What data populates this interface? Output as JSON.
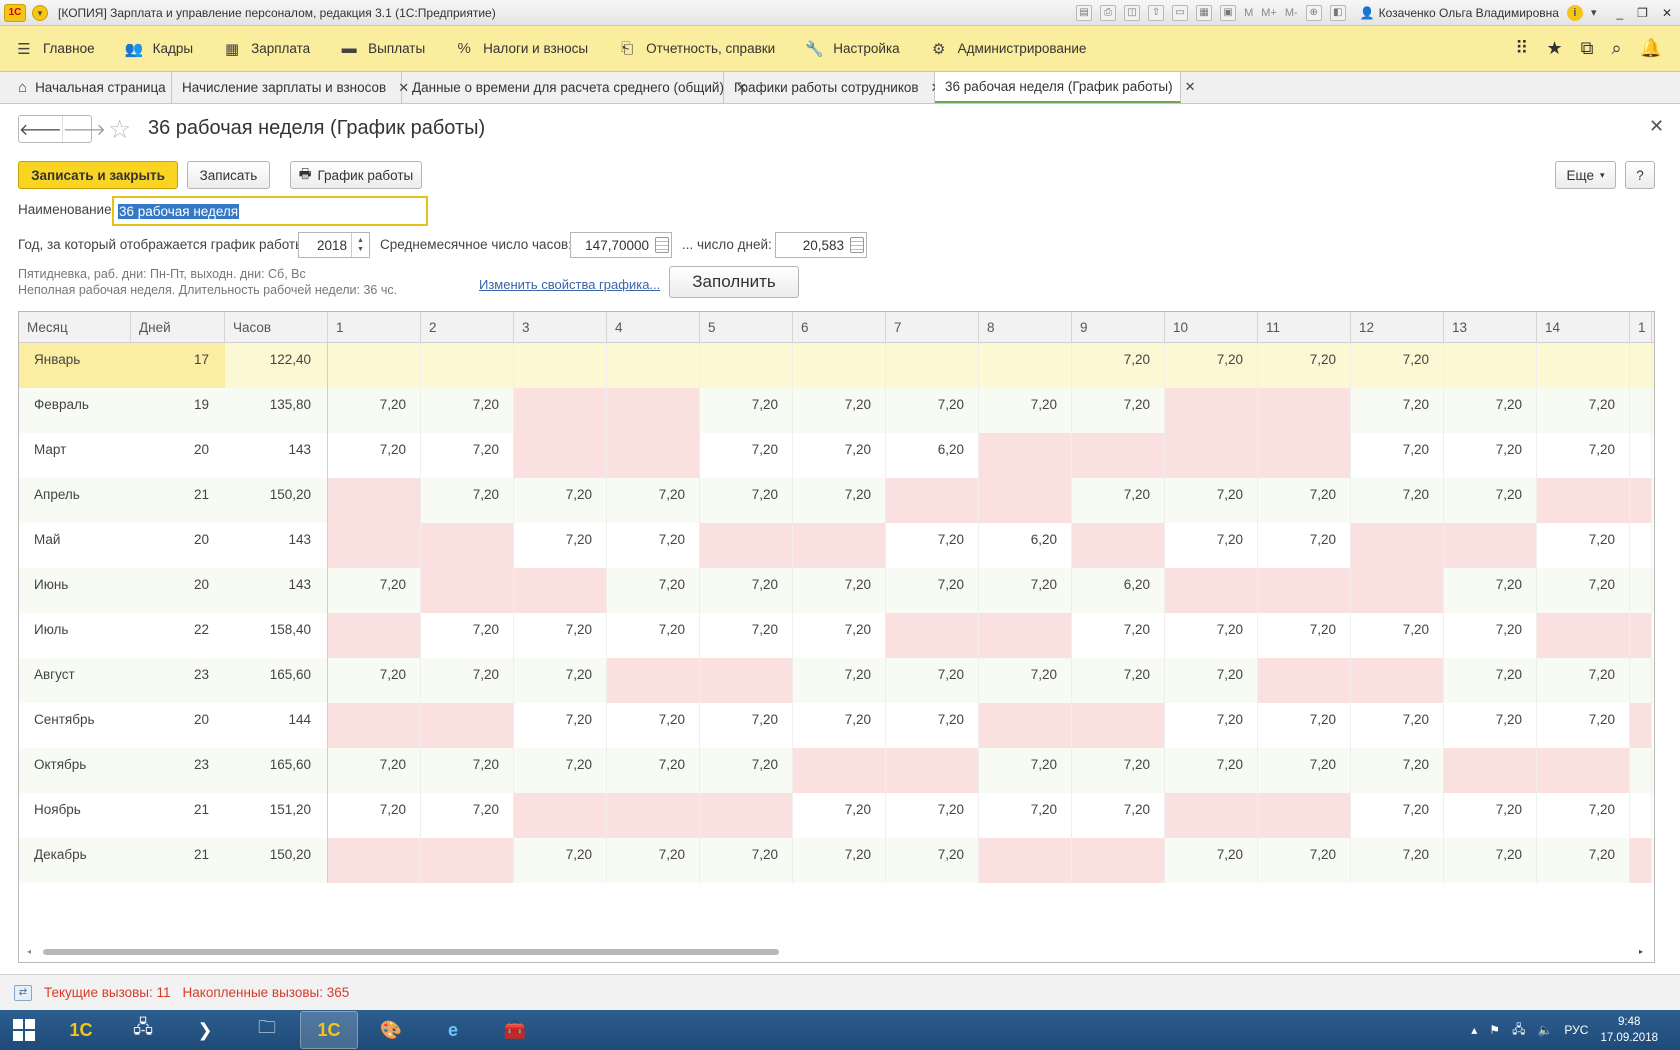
{
  "window": {
    "title": "[КОПИЯ] Зарплата и управление персоналом, редакция 3.1  (1С:Предприятие)",
    "user": "Козаченко Ольга Владимировна",
    "m_labels": [
      "M",
      "M+",
      "M-"
    ]
  },
  "main_menu": [
    {
      "label": "Главное",
      "icon": "hamburger-icon"
    },
    {
      "label": "Кадры",
      "icon": "people-icon"
    },
    {
      "label": "Зарплата",
      "icon": "calculator-icon"
    },
    {
      "label": "Выплаты",
      "icon": "wallet-icon"
    },
    {
      "label": "Налоги и взносы",
      "icon": "percent-icon"
    },
    {
      "label": "Отчетность, справки",
      "icon": "report-icon"
    },
    {
      "label": "Настройка",
      "icon": "wrench-icon"
    },
    {
      "label": "Администрирование",
      "icon": "gear-icon"
    }
  ],
  "tabs": [
    {
      "label": "Начальная страница",
      "closable": false
    },
    {
      "label": "Начисление зарплаты и взносов",
      "closable": true
    },
    {
      "label": "Данные о времени для расчета среднего (общий)",
      "closable": true
    },
    {
      "label": "Графики работы сотрудников",
      "closable": true
    },
    {
      "label": "36 рабочая неделя (График работы)",
      "closable": true,
      "active": true
    }
  ],
  "form": {
    "title": "36 рабочая неделя (График работы)",
    "buttons": {
      "save_close": "Записать и закрыть",
      "save": "Записать",
      "schedule": "График работы",
      "more": "Еще",
      "help": "?",
      "fill": "Заполнить"
    },
    "name_label": "Наименование:",
    "name_value": "36 рабочая неделя",
    "year_label": "Год, за который отображается график работы:",
    "year_value": "2018",
    "avg_hours_label": "Среднемесячное число часов:",
    "avg_hours_value": "147,70000",
    "days_label": "... число дней:",
    "days_value": "20,583",
    "hint_line1": "Пятидневка, раб. дни: Пн-Пт, выходн. дни: Сб, Вс",
    "hint_line2": "Неполная рабочая неделя. Длительность рабочей недели: 36 чс.",
    "change_link": "Изменить свойства графика..."
  },
  "table": {
    "headers": [
      "Месяц",
      "Дней",
      "Часов",
      "1",
      "2",
      "3",
      "4",
      "5",
      "6",
      "7",
      "8",
      "9",
      "10",
      "11",
      "12",
      "13",
      "14",
      "1"
    ],
    "rows": [
      {
        "month": "Январь",
        "days": "17",
        "hours": "122,40",
        "cells": [
          "",
          "",
          "",
          "",
          "",
          "",
          "",
          "",
          "7,20",
          "7,20",
          "7,20",
          "7,20",
          "",
          "",
          ""
        ],
        "weekend": [
          0,
          0,
          0,
          0,
          0,
          0,
          0,
          0,
          0,
          0,
          0,
          0,
          0,
          0,
          0
        ]
      },
      {
        "month": "Февраль",
        "days": "19",
        "hours": "135,80",
        "cells": [
          "7,20",
          "7,20",
          "",
          "",
          "7,20",
          "7,20",
          "7,20",
          "7,20",
          "7,20",
          "",
          "",
          "7,20",
          "7,20",
          "7,20",
          ""
        ],
        "weekend": [
          0,
          0,
          1,
          1,
          0,
          0,
          0,
          0,
          0,
          1,
          1,
          0,
          0,
          0,
          0
        ]
      },
      {
        "month": "Март",
        "days": "20",
        "hours": "143",
        "cells": [
          "7,20",
          "7,20",
          "",
          "",
          "7,20",
          "7,20",
          "6,20",
          "",
          "",
          "",
          "",
          "7,20",
          "7,20",
          "7,20",
          ""
        ],
        "weekend": [
          0,
          0,
          1,
          1,
          0,
          0,
          0,
          1,
          1,
          1,
          1,
          0,
          0,
          0,
          0
        ]
      },
      {
        "month": "Апрель",
        "days": "21",
        "hours": "150,20",
        "cells": [
          "",
          "7,20",
          "7,20",
          "7,20",
          "7,20",
          "7,20",
          "",
          "",
          "7,20",
          "7,20",
          "7,20",
          "7,20",
          "7,20",
          "",
          ""
        ],
        "weekend": [
          1,
          0,
          0,
          0,
          0,
          0,
          1,
          1,
          0,
          0,
          0,
          0,
          0,
          1,
          1
        ]
      },
      {
        "month": "Май",
        "days": "20",
        "hours": "143",
        "cells": [
          "",
          "",
          "7,20",
          "7,20",
          "",
          "",
          "7,20",
          "6,20",
          "",
          "7,20",
          "7,20",
          "",
          "",
          "7,20",
          ""
        ],
        "weekend": [
          1,
          1,
          0,
          0,
          1,
          1,
          0,
          0,
          1,
          0,
          0,
          1,
          1,
          0,
          0
        ]
      },
      {
        "month": "Июнь",
        "days": "20",
        "hours": "143",
        "cells": [
          "7,20",
          "",
          "",
          "7,20",
          "7,20",
          "7,20",
          "7,20",
          "7,20",
          "6,20",
          "",
          "",
          "",
          "7,20",
          "7,20",
          ""
        ],
        "weekend": [
          0,
          1,
          1,
          0,
          0,
          0,
          0,
          0,
          0,
          1,
          1,
          1,
          0,
          0,
          0
        ]
      },
      {
        "month": "Июль",
        "days": "22",
        "hours": "158,40",
        "cells": [
          "",
          "7,20",
          "7,20",
          "7,20",
          "7,20",
          "7,20",
          "",
          "",
          "7,20",
          "7,20",
          "7,20",
          "7,20",
          "7,20",
          "",
          ""
        ],
        "weekend": [
          1,
          0,
          0,
          0,
          0,
          0,
          1,
          1,
          0,
          0,
          0,
          0,
          0,
          1,
          1
        ]
      },
      {
        "month": "Август",
        "days": "23",
        "hours": "165,60",
        "cells": [
          "7,20",
          "7,20",
          "7,20",
          "",
          "",
          "7,20",
          "7,20",
          "7,20",
          "7,20",
          "7,20",
          "",
          "",
          "7,20",
          "7,20",
          ""
        ],
        "weekend": [
          0,
          0,
          0,
          1,
          1,
          0,
          0,
          0,
          0,
          0,
          1,
          1,
          0,
          0,
          0
        ]
      },
      {
        "month": "Сентябрь",
        "days": "20",
        "hours": "144",
        "cells": [
          "",
          "",
          "7,20",
          "7,20",
          "7,20",
          "7,20",
          "7,20",
          "",
          "",
          "7,20",
          "7,20",
          "7,20",
          "7,20",
          "7,20",
          ""
        ],
        "weekend": [
          1,
          1,
          0,
          0,
          0,
          0,
          0,
          1,
          1,
          0,
          0,
          0,
          0,
          0,
          1
        ]
      },
      {
        "month": "Октябрь",
        "days": "23",
        "hours": "165,60",
        "cells": [
          "7,20",
          "7,20",
          "7,20",
          "7,20",
          "7,20",
          "",
          "",
          "7,20",
          "7,20",
          "7,20",
          "7,20",
          "7,20",
          "",
          "",
          ""
        ],
        "weekend": [
          0,
          0,
          0,
          0,
          0,
          1,
          1,
          0,
          0,
          0,
          0,
          0,
          1,
          1,
          0
        ]
      },
      {
        "month": "Ноябрь",
        "days": "21",
        "hours": "151,20",
        "cells": [
          "7,20",
          "7,20",
          "",
          "",
          "",
          "7,20",
          "7,20",
          "7,20",
          "7,20",
          "",
          "",
          "7,20",
          "7,20",
          "7,20",
          ""
        ],
        "weekend": [
          0,
          0,
          1,
          1,
          1,
          0,
          0,
          0,
          0,
          1,
          1,
          0,
          0,
          0,
          0
        ]
      },
      {
        "month": "Декабрь",
        "days": "21",
        "hours": "150,20",
        "cells": [
          "",
          "",
          "7,20",
          "7,20",
          "7,20",
          "7,20",
          "7,20",
          "",
          "",
          "7,20",
          "7,20",
          "7,20",
          "7,20",
          "7,20",
          ""
        ],
        "weekend": [
          1,
          1,
          0,
          0,
          0,
          0,
          0,
          1,
          1,
          0,
          0,
          0,
          0,
          0,
          1
        ]
      }
    ]
  },
  "status": {
    "current_calls": "Текущие вызовы: 11",
    "accumulated_calls": "Накопленные вызовы: 365"
  },
  "taskbar": {
    "lang": "РУС",
    "time": "9:48",
    "date": "17.09.2018"
  }
}
